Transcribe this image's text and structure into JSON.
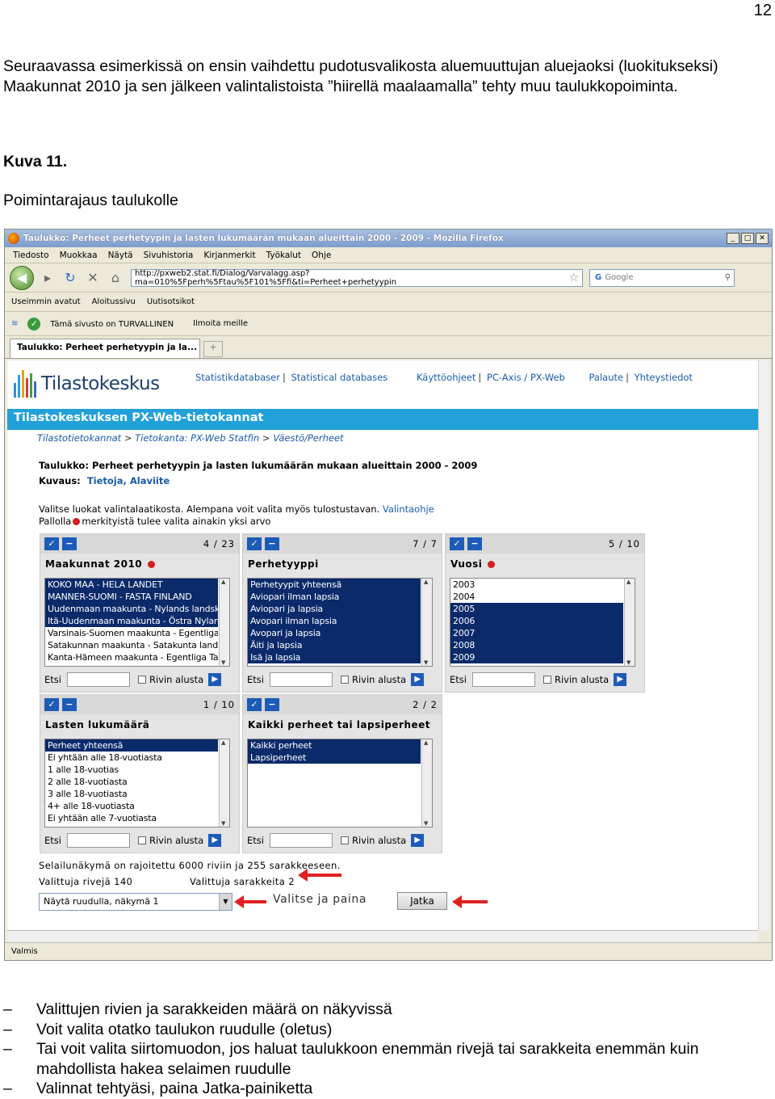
{
  "page_number": "12",
  "intro_text": "Seuraavassa esimerkissä on ensin vaihdettu pudotusvalikosta aluemuuttujan aluejaoksi (luokitukseksi) Maakunnat 2010 ja sen jälkeen valintalistoista ”hiirellä maalaamalla” tehty muu taulukkopoiminta.",
  "figure_label": "Kuva 11.",
  "figure_caption": "Poimintarajaus taulukolle",
  "browser": {
    "title": "Taulukko: Perheet perhetyypin ja lasten lukumäärän mukaan alueittain 2000 - 2009 - Mozilla Firefox",
    "menu": [
      "Tiedosto",
      "Muokkaa",
      "Näytä",
      "Sivuhistoria",
      "Kirjanmerkit",
      "Työkalut",
      "Ohje"
    ],
    "url": "http://pxweb2.stat.fi/Dialog/Varvalagg.asp?ma=010%5Fperh%5Ftau%5F101%5Ffi&ti=Perheet+perhetyypin",
    "search_placeholder": "Google",
    "bookmarks": [
      "Useimmin avatut",
      "Aloitussivu",
      "Uutisotsikot"
    ],
    "security_text": "Tämä sivusto on TURVALLINEN",
    "report_text": "Ilmoita meille",
    "tab_label": "Taulukko: Perheet perhetyypin ja la...",
    "status": "Valmis"
  },
  "site": {
    "logo": "Tilastokeskus",
    "links": [
      "Statistikdatabaser",
      "Statistical databases",
      "Käyttöohjeet",
      "PC-Axis / PX-Web",
      "Palaute",
      "Yhteystiedot"
    ],
    "banner": "Tilastokeskuksen PX-Web-tietokannat",
    "breadcrumb": [
      "Tilastotietokannat",
      "Tietokanta: PX-Web Statfin",
      "Väestö/Perheet"
    ],
    "table_label": "Taulukko:",
    "table_title": "Perheet perhetyypin ja lasten lukumäärän mukaan alueittain 2000 - 2009",
    "kuvaus_label": "Kuvaus:",
    "kuvaus_value": "Tietoja, Alaviite",
    "instruction_1": "Valitse luokat valintalaatikosta. Alempana voit valita myös tulostustavan.",
    "instruction_link": "Valintaohje",
    "instruction_2a": "Pallolla",
    "instruction_2b": "merkityistä tulee valita ainakin yksi arvo"
  },
  "variables": [
    {
      "name": "Maakunnat 2010",
      "count": "4 / 23",
      "required": true,
      "items": [
        "KOKO MAA - HELA LANDET",
        "MANNER-SUOMI - FASTA FINLAND",
        "Uudenmaan maakunta - Nylands landskap",
        "Itä-Uudenmaan maakunta - Östra Nylands",
        "Varsinais-Suomen maakunta - Egentliga",
        "Satakunnan maakunta - Satakunta landskap",
        "Kanta-Hämeen maakunta - Egentliga Tavastland"
      ],
      "selected": [
        0,
        1,
        2,
        3
      ]
    },
    {
      "name": "Perhetyyppi",
      "count": "7 / 7",
      "required": false,
      "items": [
        "Perhetyypit yhteensä",
        "Aviopari ilman lapsia",
        "Aviopari ja lapsia",
        "Avopari ilman lapsia",
        "Avopari ja lapsia",
        "Äiti ja lapsia",
        "Isä ja lapsia"
      ],
      "selected": [
        0,
        1,
        2,
        3,
        4,
        5,
        6
      ]
    },
    {
      "name": "Vuosi",
      "count": "5 / 10",
      "required": true,
      "items": [
        "2003",
        "2004",
        "2005",
        "2006",
        "2007",
        "2008",
        "2009"
      ],
      "selected": [
        2,
        3,
        4,
        5,
        6
      ]
    },
    {
      "name": "Lasten lukumäärä",
      "count": "1 / 10",
      "required": false,
      "items": [
        "Perheet yhteensä",
        "Ei yhtään alle 18-vuotiasta",
        "1 alle 18-vuotias",
        "2 alle 18-vuotiasta",
        "3 alle 18-vuotiasta",
        "4+ alle 18-vuotiasta",
        "Ei yhtään alle 7-vuotiasta"
      ],
      "selected": [
        0
      ]
    },
    {
      "name": "Kaikki perheet tai lapsiperheet",
      "count": "2 / 2",
      "required": false,
      "items": [
        "Kaikki perheet",
        "Lapsiperheet"
      ],
      "selected": [
        0,
        1
      ]
    }
  ],
  "search_label": "Etsi",
  "rivin_alusta": "Rivin alusta",
  "limits_text": "Selailunäkymä on rajoitettu 6000 riviin ja 255 sarakkeeseen.",
  "rows_selected": "Valittuja rivejä 140",
  "cols_selected": "Valittuja sarakkeita 2",
  "output_option": "Näytä ruudulla, näkymä 1",
  "choose_text": "Valitse ja paina",
  "continue_button": "Jatka",
  "bullets": [
    "Valittujen rivien ja sarakkeiden määrä on näkyvissä",
    "Voit valita otatko taulukon ruudulle (oletus)",
    "Tai voit valita siirtomuodon, jos haluat taulukkoon enemmän rivejä tai sarakkeita enemmän kuin mahdollista hakea selaimen ruudulle",
    "Valinnat tehtyäsi, paina Jatka-painiketta"
  ]
}
